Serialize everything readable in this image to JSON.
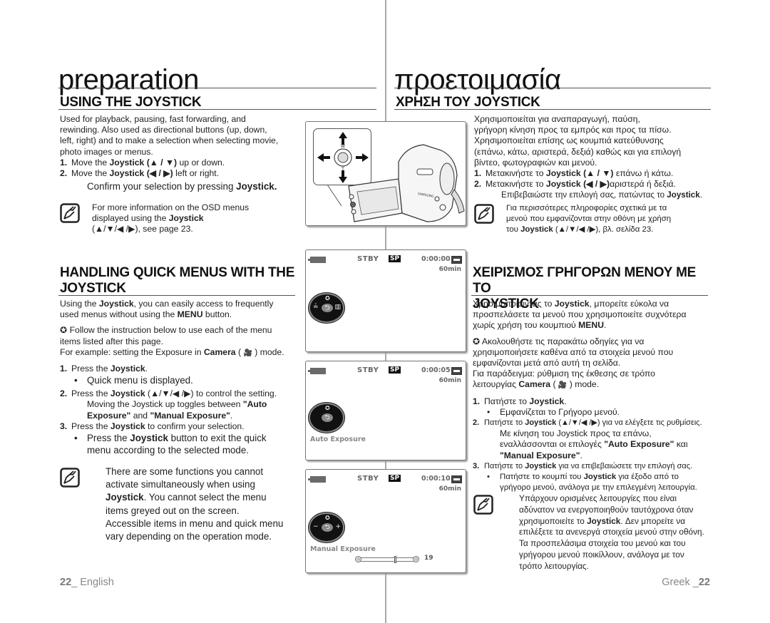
{
  "left": {
    "chapter_title": "preparation",
    "section1": {
      "title": "USING THE JOYSTICK",
      "intro_lines": [
        "Used for playback, pausing, fast forwarding, and",
        "rewinding. Also used as directional buttons (up, down,",
        "left, right) and to make a selection when selecting movie,",
        "photo images or menus."
      ],
      "steps": [
        {
          "num": "1.",
          "pre": "Move the ",
          "bold": "Joystick",
          "sym": " (▲ / ▼)",
          "post": " up or down."
        },
        {
          "num": "2.",
          "pre": "Move the ",
          "bold": "Joystick",
          "sym": " (◀ / ▶)",
          "post": " left or right."
        }
      ],
      "confirm": {
        "pre": "Confirm your selection by pressing ",
        "bold": "Joystick."
      },
      "note_lines": {
        "l1": "For more information on the OSD menus",
        "l2_pre": "displayed using the ",
        "l2_bold": "Joystick",
        "l3": "(▲/▼/◀ /▶), see page 23."
      }
    },
    "section2": {
      "title_line1": "HANDLING QUICK MENUS WITH THE",
      "title_line2": "JOYSTICK",
      "intro": {
        "l1_pre": "Using the ",
        "l1_bold": "Joystick",
        "l1_post": ", you can easily access to frequently",
        "l2_pre": "used menus without using the ",
        "l2_bold": "MENU",
        "l2_post": " button."
      },
      "follow_lines": [
        "✪ Follow the instruction below to use each of the menu",
        "items listed after this page."
      ],
      "example": {
        "pre": "For example: setting the Exposure in ",
        "bold": "Camera",
        "mid": " ( ",
        "icon": "🎥",
        "post": " ) mode."
      },
      "step1": {
        "num": "1.",
        "pre": "Press the ",
        "bold": "Joystick",
        "post": "."
      },
      "step1_bullet": "Quick menu is displayed.",
      "step2": {
        "num": "2.",
        "pre": "Press the ",
        "bold": "Joystick",
        "post": " (▲/▼/◀ /▶) to control the setting."
      },
      "step2_sub1": {
        "pre": "Moving the Joystick up toggles between ",
        "bold": "\"Auto"
      },
      "step2_sub2": {
        "bold1": "Exposure\"",
        "mid": " and ",
        "bold2": "\"Manual Exposure\"",
        "post": "."
      },
      "step3": {
        "num": "3.",
        "pre": "Press the ",
        "bold": "Joystick",
        "post": " to confirm your selection."
      },
      "step3_bullet": {
        "pre": "Press the ",
        "bold": "Joystick",
        "post": " button to exit the quick"
      },
      "step3_bullet_l2": "menu according to the selected mode.",
      "note": {
        "l1": "There are some functions you cannot",
        "l2": "activate simultaneously when using",
        "l3_bold": "Joystick",
        "l3_post": ". You cannot select the menu",
        "l4": "items greyed out on the screen.",
        "l5": "Accessible items in menu and quick menu",
        "l6": "vary depending on the operation mode."
      }
    },
    "footer": {
      "page": "22",
      "sep": "_ ",
      "lang": "English"
    }
  },
  "right": {
    "chapter_title": "προετοιμασία",
    "section1": {
      "title": "ΧΡΗΣΗ ΤΟΥ JOYSTICK",
      "intro_lines": [
        "Χρησιμοποιείται για αναπαραγωγή, παύση,",
        "γρήγορη κίνηση προς τα εμπρός και προς τα πίσω.",
        "Χρησιμοποιείται επίσης ως κουμπιά κατεύθυνσης",
        "(επάνω, κάτω, αριστερά, δεξιά) καθώς και για επιλογή",
        "βίντεο, φωτογραφιών και μενού."
      ],
      "steps": [
        {
          "num": "1.",
          "pre": "Μετακινήστε το ",
          "bold": "Joystick (▲ / ▼)",
          "post": " επάνω ή κάτω."
        },
        {
          "num": "2.",
          "pre": "Μετακινήστε το ",
          "bold": "Joystick  (◀ / ▶)",
          "post": "αριστερά ή δεξιά."
        }
      ],
      "confirm": {
        "pre": "Επιβεβαιώστε την επιλογή σας, πατώντας το ",
        "bold": "Joystick",
        "post": "."
      },
      "note_lines": {
        "l1": "Για περισσότερες πληροφορίες σχετικά με τα",
        "l2": "μενού που εμφανίζονται στην οθόνη με χρήση",
        "l3_pre": "του ",
        "l3_bold": "Joystick",
        "l3_post": " (▲/▼/◀ /▶), βλ. σελίδα 23."
      }
    },
    "section2": {
      "title_line1": "ΧΕΙΡΙΣΜΟΣ ΓΡΗΓΟΡΩΝ ΜΕΝΟΥ ΜΕ ΤΟ",
      "title_line2": "JOYSTICK",
      "intro": {
        "l1_pre": "Χρησιμοποιώντας το ",
        "l1_bold": "Joystick",
        "l1_post": ", μπορείτε εύκολα να",
        "l2": "προσπελάσετε τα μενού που χρησιμοποιείτε συχνότερα",
        "l3_pre": "χωρίς χρήση του κουμπιού ",
        "l3_bold": "MENU",
        "l3_post": "."
      },
      "follow_lines": [
        "✪ Ακολουθήστε τις παρακάτω οδηγίες για να",
        "χρησιμοποιήσετε καθένα από τα στοιχεία μενού που",
        "εμφανίζονται μετά από αυτή τη σελίδα."
      ],
      "example_l1": "Για παράδειγμα: ρύθμιση της έκθεσης σε τρόπο",
      "example_l2": {
        "pre": "λειτουργίας ",
        "bold": "Camera",
        "mid": " ( ",
        "icon": "🎥",
        "post": " ) mode."
      },
      "step1": {
        "num": "1.",
        "pre": "Πατήστε το ",
        "bold": "Joystick",
        "post": "."
      },
      "step1_bullet": "Εμφανίζεται το Γρήγορο μενού.",
      "step2": {
        "num": "2.",
        "pre": "Πατήστε το ",
        "bold": "Joystick",
        "post": " (▲/▼/◀ /▶) για να ελέγξετε τις ρυθμίσεις."
      },
      "step2_sub1": "Με κίνηση του Joystick προς τα επάνω,",
      "step2_sub2": {
        "pre": "εναλλάσσονται οι επιλογές ",
        "bold": "\"Auto Exposure\"",
        "post": " και"
      },
      "step2_sub3": {
        "bold": "\"Manual Exposure\"",
        "post": "."
      },
      "step3": {
        "num": "3.",
        "pre": "Πατήστε το ",
        "bold": "Joystick",
        "post": " για να επιβεβαιώσετε την επιλογή σας."
      },
      "step3_bullet": {
        "pre": "Πατήστε το κουμπί του ",
        "bold": "Joystick",
        "post": " για έξοδο από το"
      },
      "step3_bullet_l2": "γρήγορο μενού, ανάλογα με την επιλεγμένη λειτουργία.",
      "note": {
        "l1": "Υπάρχουν ορισμένες λειτουργίες που είναι",
        "l2": "αδύνατον να ενεργοποιηθούν ταυτόχρονα όταν",
        "l3_pre": "χρησιμοποιείτε το ",
        "l3_bold": "Joystick",
        "l3_post": ". Δεν μπορείτε να",
        "l4": "επιλέξετε τα ανενεργά στοιχεία μενού στην οθόνη.",
        "l5": "Τα προσπελάσιμα στοιχεία του μενού και του",
        "l6": "γρήγορου μενού ποικίλλουν, ανάλογα με τον",
        "l7": "τρόπο λειτουργίας."
      }
    },
    "footer": {
      "lang": "Greek",
      "sep": " _",
      "page": "22"
    }
  },
  "illustration": {
    "joystick_labels": {
      "top": "W",
      "bottom": "T"
    },
    "camera_brand": "SAMSUNG"
  },
  "screens": [
    {
      "status": "STBY",
      "quality": "SP",
      "timecode": "0:00:00",
      "remaining": "60min",
      "dial": {
        "top": "✪",
        "left": "≟",
        "right": "▥",
        "bottom": "⁚ ⁚"
      },
      "label": ""
    },
    {
      "status": "STBY",
      "quality": "SP",
      "timecode": "0:00:05",
      "remaining": "60min",
      "dial": {
        "top": "✪",
        "left": "",
        "right": "",
        "bottom": ""
      },
      "label": "Auto Exposure"
    },
    {
      "status": "STBY",
      "quality": "SP",
      "timecode": "0:00:10",
      "remaining": "60min",
      "dial": {
        "top": "✪",
        "left": "−",
        "right": "+",
        "bottom": ""
      },
      "label": "Manual Exposure",
      "slider": {
        "value": "19",
        "min": 0,
        "max": 29,
        "position": 19
      }
    }
  ],
  "icons": {
    "back": "⮌"
  }
}
